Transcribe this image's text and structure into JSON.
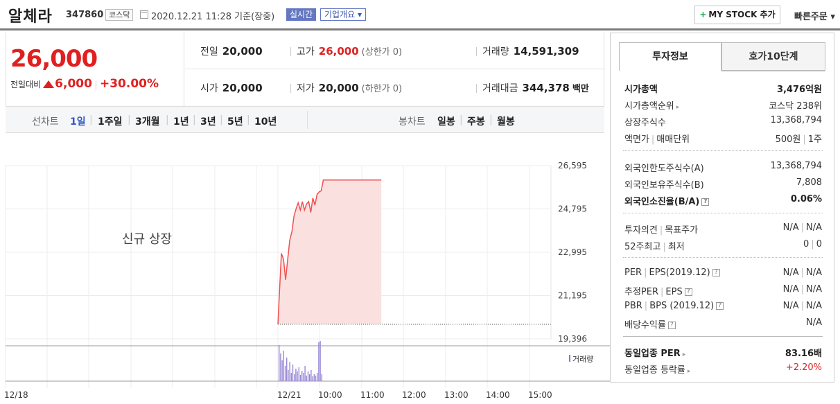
{
  "header": {
    "name": "알체라",
    "code": "347860",
    "market": "코스닥",
    "datetime": "2020.12.21 11:28",
    "basis": "기준(장중)",
    "realtime": "실시간",
    "overview": "기업개요",
    "mystock": "MY STOCK 추가",
    "quick_order": "빠른주문"
  },
  "price": {
    "current": "26,000",
    "change_label": "전일대비",
    "change": "6,000",
    "rate": "+30.00%"
  },
  "stats": {
    "prev": {
      "label": "전일",
      "value": "20,000"
    },
    "high": {
      "label": "고가",
      "value": "26,000",
      "sub": "(상한가 0)"
    },
    "volume": {
      "label": "거래량",
      "value": "14,591,309"
    },
    "open": {
      "label": "시가",
      "value": "20,000"
    },
    "low": {
      "label": "저가",
      "value": "20,000",
      "sub": "(하한가 0)"
    },
    "amount": {
      "label": "거래대금",
      "value": "344,378",
      "unit": "백만"
    }
  },
  "line_tabs": {
    "label": "선차트",
    "items": [
      "1일",
      "1주일",
      "3개월",
      "1년",
      "3년",
      "5년",
      "10년"
    ],
    "active": "1일"
  },
  "candle_tabs": {
    "label": "봉차트",
    "items": [
      "일봉",
      "주봉",
      "월봉"
    ]
  },
  "chart_data": {
    "type": "area",
    "annotation": "신규 상장",
    "volume_label": "거래량",
    "y_ticks": [
      "26,595",
      "24,795",
      "22,995",
      "21,195",
      "19,396"
    ],
    "ylim": [
      19396,
      26595
    ],
    "x_ticks": [
      "12/18",
      "12/21",
      "10:00",
      "11:00",
      "12:00",
      "13:00",
      "14:00",
      "15:00"
    ],
    "baseline": 20000,
    "time_minutes": [
      0,
      2,
      5,
      8,
      11,
      14,
      17,
      20,
      23,
      26,
      29,
      32,
      35,
      38,
      41,
      44,
      47,
      50,
      53,
      56,
      59,
      62,
      65,
      68,
      71,
      74,
      77,
      80,
      83,
      86,
      89,
      148
    ],
    "values": [
      20000,
      21200,
      22950,
      22700,
      21850,
      22700,
      23500,
      23850,
      24500,
      24800,
      25050,
      24750,
      25100,
      24750,
      25000,
      25100,
      24650,
      25250,
      24950,
      25400,
      25500,
      25550,
      26000,
      26000,
      26000,
      26000,
      26000,
      26000,
      26000,
      26000,
      26000,
      26000
    ],
    "grid": true
  },
  "panel": {
    "tab_active": "투자정보",
    "tab_other": "호가10단계",
    "rows1": [
      {
        "label": "시가총액",
        "value": "3,476억원"
      },
      {
        "label": "시가총액순위",
        "value": "코스닥 238위"
      },
      {
        "label": "상장주식수",
        "value": "13,368,794"
      },
      {
        "label": "액면가",
        "label2": "매매단위",
        "value": "500원",
        "value2": "1주"
      }
    ],
    "rows2": [
      {
        "label": "외국인한도주식수(A)",
        "value": "13,368,794"
      },
      {
        "label": "외국인보유주식수(B)",
        "value": "7,808"
      },
      {
        "label": "외국인소진율(B/A)",
        "value": "0.06%"
      }
    ],
    "rows3": [
      {
        "label": "투자의견",
        "label2": "목표주가",
        "value": "N/A",
        "value2": "N/A"
      },
      {
        "label": "52주최고",
        "label2": "최저",
        "value": "0",
        "value2": "0"
      }
    ],
    "rows4": [
      {
        "label": "PER",
        "label2": "EPS(2019.12)",
        "value": "N/A",
        "value2": "N/A"
      },
      {
        "label": "추정PER",
        "label2": "EPS",
        "value": "N/A",
        "value2": "N/A"
      },
      {
        "label": "PBR",
        "label2": "BPS (2019.12)",
        "value": "N/A",
        "value2": "N/A"
      },
      {
        "label": "배당수익률",
        "value": "N/A"
      }
    ],
    "rows5": [
      {
        "label": "동일업종 PER",
        "value": "83.16배"
      },
      {
        "label": "동일업종 등락률",
        "value": "+2.20%"
      }
    ]
  }
}
